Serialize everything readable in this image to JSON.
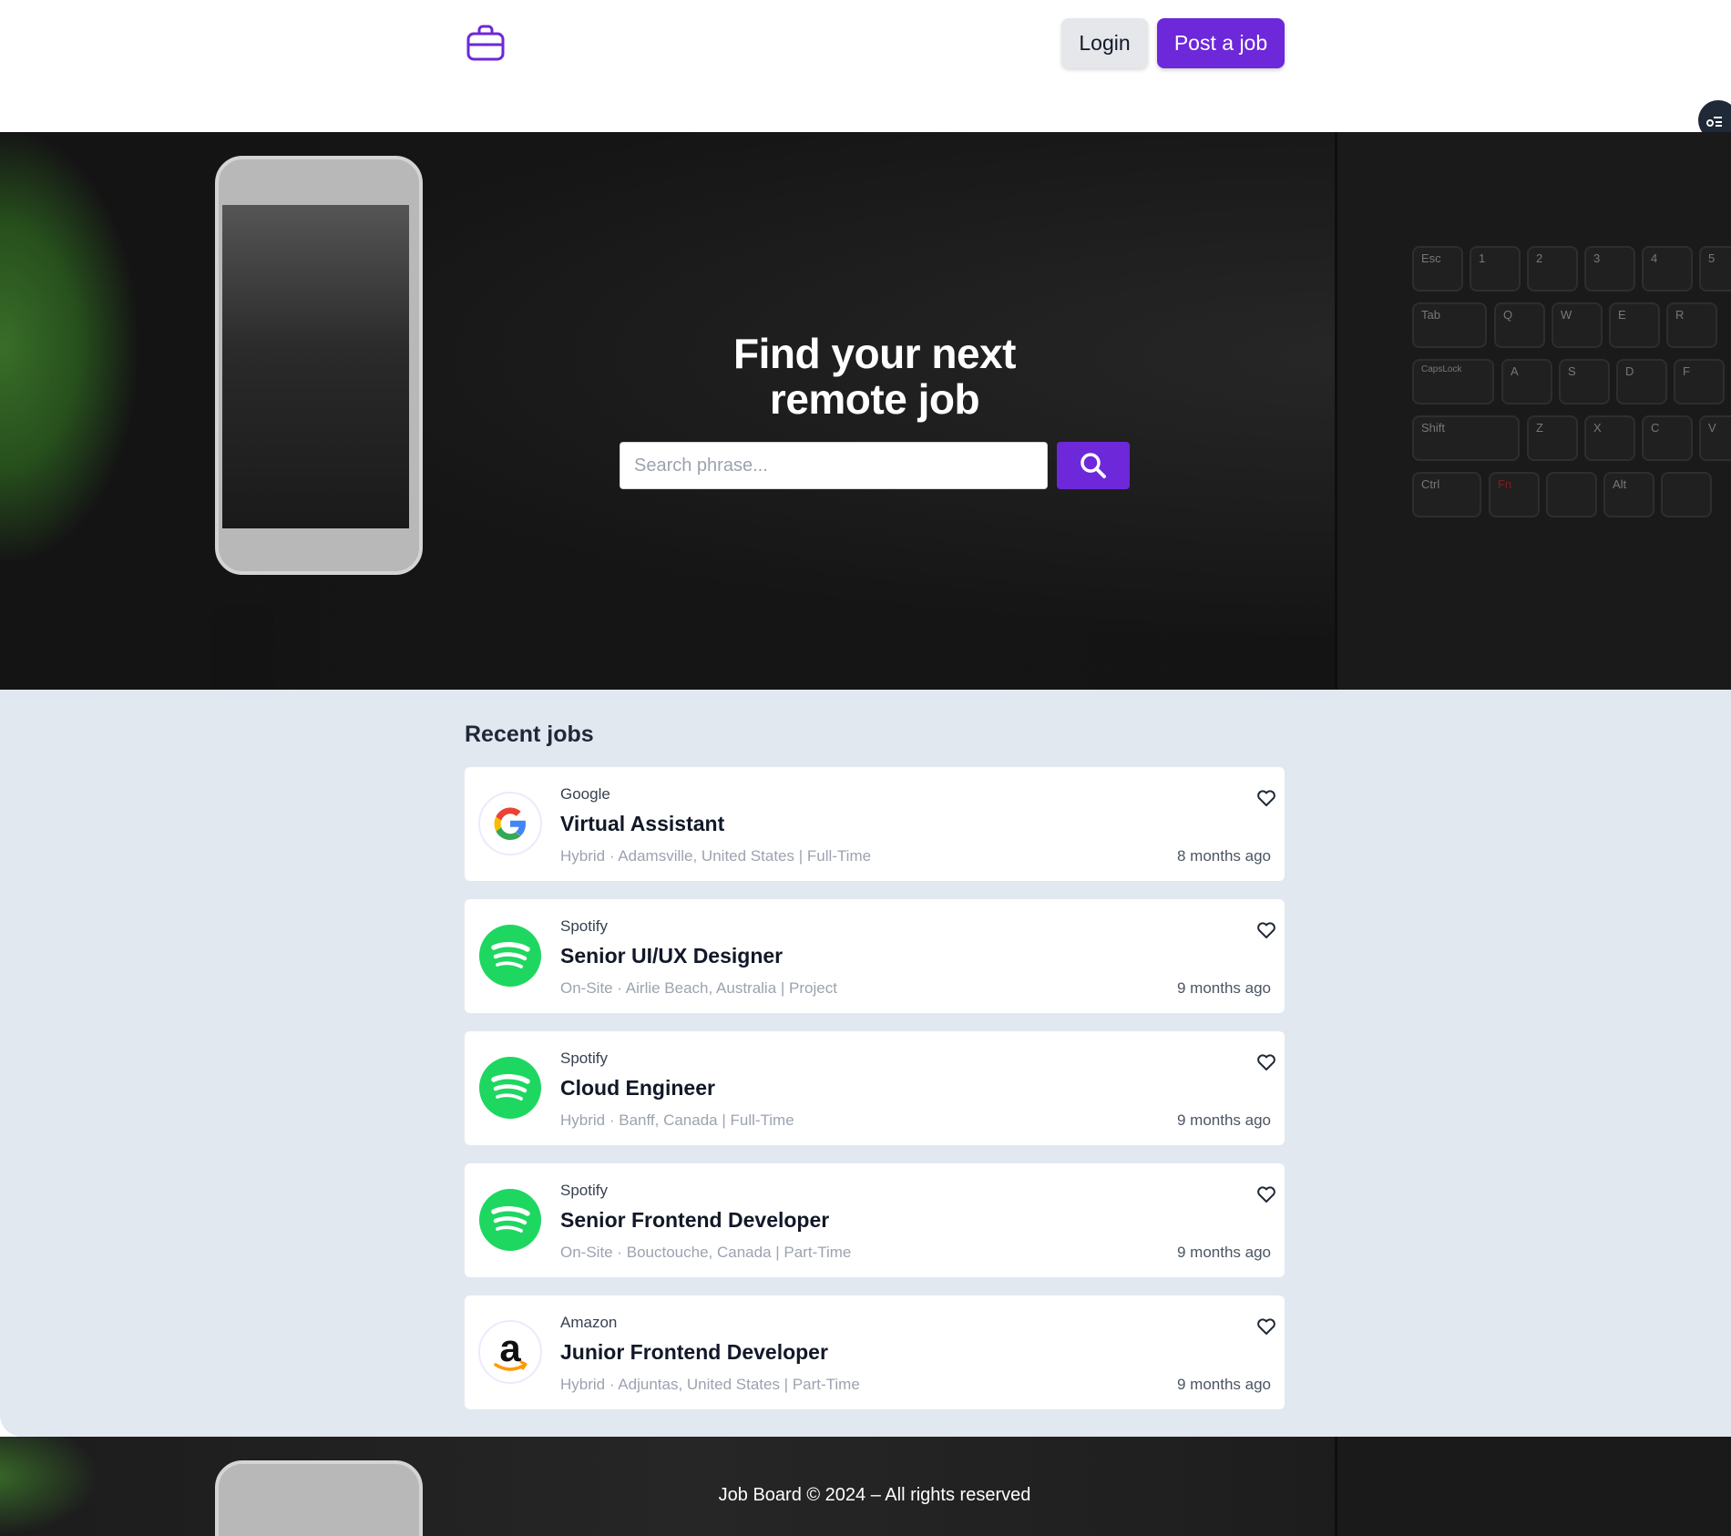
{
  "header": {
    "logo_icon": "briefcase-icon",
    "login_label": "Login",
    "post_job_label": "Post a job"
  },
  "hero": {
    "title_line1": "Find your next",
    "title_line2": "remote job",
    "search_placeholder": "Search phrase...",
    "search_icon": "search-icon",
    "keys": [
      {
        "label": "Esc"
      },
      {
        "label": "1"
      },
      {
        "label": "2"
      },
      {
        "label": "3"
      },
      {
        "label": "4"
      },
      {
        "label": "5"
      },
      {
        "label": "Tab"
      },
      {
        "label": "Q"
      },
      {
        "label": "W"
      },
      {
        "label": "E"
      },
      {
        "label": "R"
      },
      {
        "label": "CapsLock"
      },
      {
        "label": "A"
      },
      {
        "label": "S"
      },
      {
        "label": "D"
      },
      {
        "label": "F"
      },
      {
        "label": "Shift"
      },
      {
        "label": "Z"
      },
      {
        "label": "X"
      },
      {
        "label": "C"
      },
      {
        "label": "V"
      },
      {
        "label": "Ctrl"
      },
      {
        "label": "Fn"
      },
      {
        "label": ""
      },
      {
        "label": "Alt"
      },
      {
        "label": ""
      }
    ]
  },
  "jobs": {
    "heading": "Recent jobs",
    "items": [
      {
        "company": "Google",
        "title": "Virtual Assistant",
        "meta": "Hybrid · Adamsville, United States | Full-Time",
        "time": "8 months ago",
        "logo": "google-logo"
      },
      {
        "company": "Spotify",
        "title": "Senior UI/UX Designer",
        "meta": "On-Site · Airlie Beach, Australia | Project",
        "time": "9 months ago",
        "logo": "spotify-logo"
      },
      {
        "company": "Spotify",
        "title": "Cloud Engineer",
        "meta": "Hybrid · Banff, Canada | Full-Time",
        "time": "9 months ago",
        "logo": "spotify-logo"
      },
      {
        "company": "Spotify",
        "title": "Senior Frontend Developer",
        "meta": "On-Site · Bouctouche, Canada | Part-Time",
        "time": "9 months ago",
        "logo": "spotify-logo"
      },
      {
        "company": "Amazon",
        "title": "Junior Frontend Developer",
        "meta": "Hybrid · Adjuntas, United States | Part-Time",
        "time": "9 months ago",
        "logo": "amazon-logo"
      }
    ]
  },
  "footer": {
    "text": "Job Board © 2024 – All rights reserved"
  },
  "colors": {
    "accent": "#6d28d9",
    "section_bg": "#e2e8f0",
    "spotify_green": "#1ed760",
    "amazon_orange": "#ff9900"
  }
}
